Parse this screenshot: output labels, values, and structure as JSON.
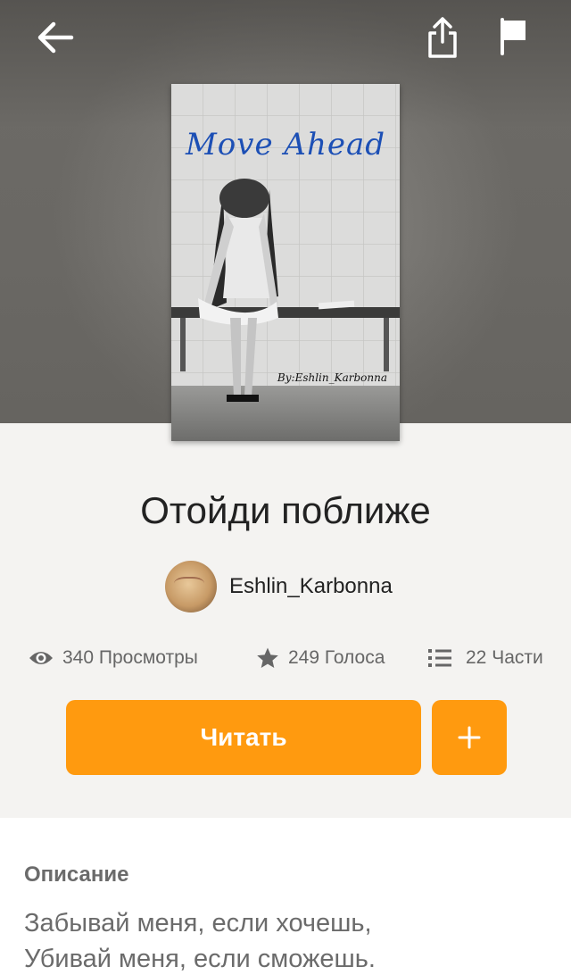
{
  "header": {
    "back_icon": "arrow-left-icon",
    "share_icon": "share-icon",
    "flag_icon": "flag-icon"
  },
  "cover": {
    "title": "Move Ahead",
    "byline": "By:Eshlin_Karbonna"
  },
  "story": {
    "title": "Отойди поближе",
    "author": "Eshlin_Karbonna"
  },
  "stats": {
    "views": "340 Просмотры",
    "votes": "249 Голоса",
    "parts": "22 Части"
  },
  "actions": {
    "read_label": "Читать",
    "add_label": "+"
  },
  "description": {
    "heading": "Описание",
    "lines": [
      "Забывай меня, если хочешь,",
      "Убивай меня, если сможешь."
    ]
  },
  "colors": {
    "accent": "#ff9a0f",
    "cover_title": "#1c4fb5"
  }
}
